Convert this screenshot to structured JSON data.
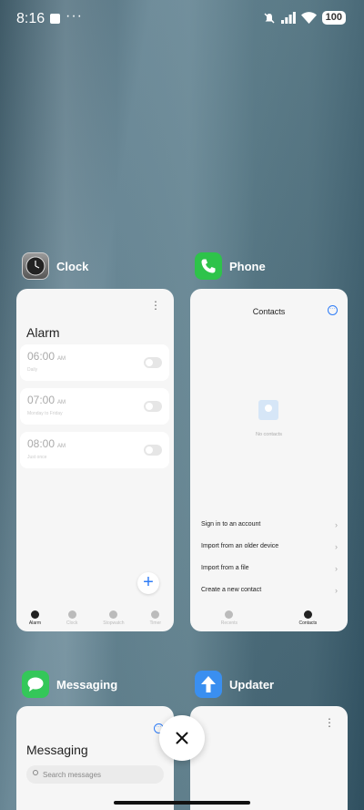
{
  "status_bar": {
    "time": "8:16",
    "battery": "100",
    "icons": [
      "notification-square-icon",
      "more-dots-icon",
      "mute-icon",
      "signal-icon",
      "wifi-icon",
      "battery-icon"
    ]
  },
  "apps": [
    {
      "name": "Clock",
      "icon": "clock-icon",
      "screen": {
        "title": "Alarm",
        "alarms": [
          {
            "time": "06:00",
            "ampm": "AM",
            "sub": "Daily"
          },
          {
            "time": "07:00",
            "ampm": "AM",
            "sub": "Monday to Friday"
          },
          {
            "time": "08:00",
            "ampm": "AM",
            "sub": "Just once"
          }
        ],
        "nav": [
          "Alarm",
          "Clock",
          "Stopwatch",
          "Timer"
        ],
        "active_nav": "Alarm"
      }
    },
    {
      "name": "Phone",
      "icon": "phone-icon",
      "screen": {
        "title": "Contacts",
        "empty_text": "No contacts",
        "options": [
          "Sign in to an account",
          "Import from an older device",
          "Import from a file",
          "Create a new contact"
        ],
        "nav": [
          "Recents",
          "Contacts"
        ],
        "active_nav": "Contacts"
      }
    },
    {
      "name": "Messaging",
      "icon": "messaging-icon",
      "screen": {
        "title": "Messaging",
        "search_placeholder": "Search messages"
      }
    },
    {
      "name": "Updater",
      "icon": "updater-icon",
      "screen": {}
    }
  ],
  "colors": {
    "accent": "#2f7cf6",
    "phone_green": "#2ec34a",
    "updater_blue": "#3a8ff0"
  }
}
